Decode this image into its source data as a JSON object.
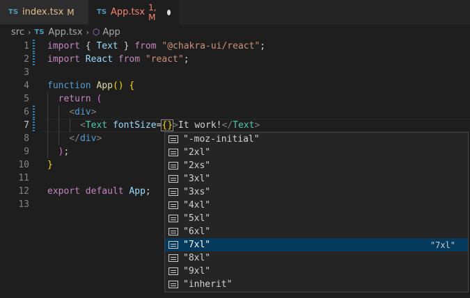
{
  "tabs": [
    {
      "icon": "TS",
      "label": "index.tsx",
      "status": "M"
    },
    {
      "icon": "TS",
      "label": "App.tsx",
      "status": "1, M"
    }
  ],
  "breadcrumb": {
    "folder": "src",
    "file": "App.tsx",
    "symbol": "App"
  },
  "lines": [
    {
      "n": "1",
      "tokens": [
        [
          "kw",
          "import"
        ],
        [
          "punc",
          " { "
        ],
        [
          "id",
          "Text"
        ],
        [
          "punc",
          " } "
        ],
        [
          "kw",
          "from"
        ],
        [
          "punc",
          " "
        ],
        [
          "str",
          "\"@chakra-ui/react\""
        ],
        [
          "punc",
          ";"
        ]
      ]
    },
    {
      "n": "2",
      "tokens": [
        [
          "kw",
          "import"
        ],
        [
          "punc",
          " "
        ],
        [
          "id",
          "React"
        ],
        [
          "punc",
          " "
        ],
        [
          "kw",
          "from"
        ],
        [
          "punc",
          " "
        ],
        [
          "str",
          "\"react\""
        ],
        [
          "punc",
          ";"
        ]
      ]
    },
    {
      "n": "3",
      "tokens": []
    },
    {
      "n": "4",
      "tokens": [
        [
          "kw2",
          "function"
        ],
        [
          "punc",
          " "
        ],
        [
          "fn",
          "App"
        ],
        [
          "br",
          "()"
        ],
        [
          "punc",
          " "
        ],
        [
          "br",
          "{"
        ]
      ]
    },
    {
      "n": "5",
      "tokens": [
        [
          "punc",
          "  "
        ],
        [
          "kw",
          "return"
        ],
        [
          "punc",
          " "
        ],
        [
          "br2",
          "("
        ]
      ]
    },
    {
      "n": "6",
      "tokens": [
        [
          "punc",
          "    "
        ],
        [
          "tag",
          "<"
        ],
        [
          "kw2",
          "div"
        ],
        [
          "tag",
          ">"
        ]
      ]
    },
    {
      "n": "7",
      "tokens": [
        [
          "punc",
          "      "
        ],
        [
          "tag",
          "<"
        ],
        [
          "type",
          "Text"
        ],
        [
          "punc",
          " "
        ],
        [
          "id",
          "fontSize"
        ],
        [
          "punc",
          "="
        ],
        [
          "br",
          "{}"
        ],
        [
          "tag",
          ">"
        ],
        [
          "punc",
          "It work!"
        ],
        [
          "tag",
          "</"
        ],
        [
          "type",
          "Text"
        ],
        [
          "tag",
          ">"
        ]
      ]
    },
    {
      "n": "8",
      "tokens": [
        [
          "punc",
          "    "
        ],
        [
          "tag",
          "</"
        ],
        [
          "kw2",
          "div"
        ],
        [
          "tag",
          ">"
        ]
      ]
    },
    {
      "n": "9",
      "tokens": [
        [
          "punc",
          "  "
        ],
        [
          "br2",
          ")"
        ],
        [
          "punc",
          ";"
        ]
      ]
    },
    {
      "n": "10",
      "tokens": [
        [
          "br",
          "}"
        ]
      ]
    },
    {
      "n": "11",
      "tokens": []
    },
    {
      "n": "12",
      "tokens": [
        [
          "kw",
          "export"
        ],
        [
          "punc",
          " "
        ],
        [
          "kw",
          "default"
        ],
        [
          "punc",
          " "
        ],
        [
          "id",
          "App"
        ],
        [
          "punc",
          ";"
        ]
      ]
    },
    {
      "n": "13",
      "tokens": []
    }
  ],
  "suggestions": [
    {
      "label": "\"-moz-initial\""
    },
    {
      "label": "\"2xl\""
    },
    {
      "label": "\"2xs\""
    },
    {
      "label": "\"3xl\""
    },
    {
      "label": "\"3xs\""
    },
    {
      "label": "\"4xl\""
    },
    {
      "label": "\"5xl\""
    },
    {
      "label": "\"6xl\""
    },
    {
      "label": "\"7xl\"",
      "detail": "\"7xl\"",
      "selected": true
    },
    {
      "label": "\"8xl\""
    },
    {
      "label": "\"9xl\""
    },
    {
      "label": "\"inherit\""
    }
  ],
  "icons": {
    "tab": "typescript-icon",
    "breadcrumb_symbol": "symbol-cube-icon",
    "suggestion": "enum-member-icon"
  },
  "colors": {
    "selected_suggestion": "#04395e",
    "active_tab_text": "#f48771",
    "modified_text": "#e2c08d"
  }
}
